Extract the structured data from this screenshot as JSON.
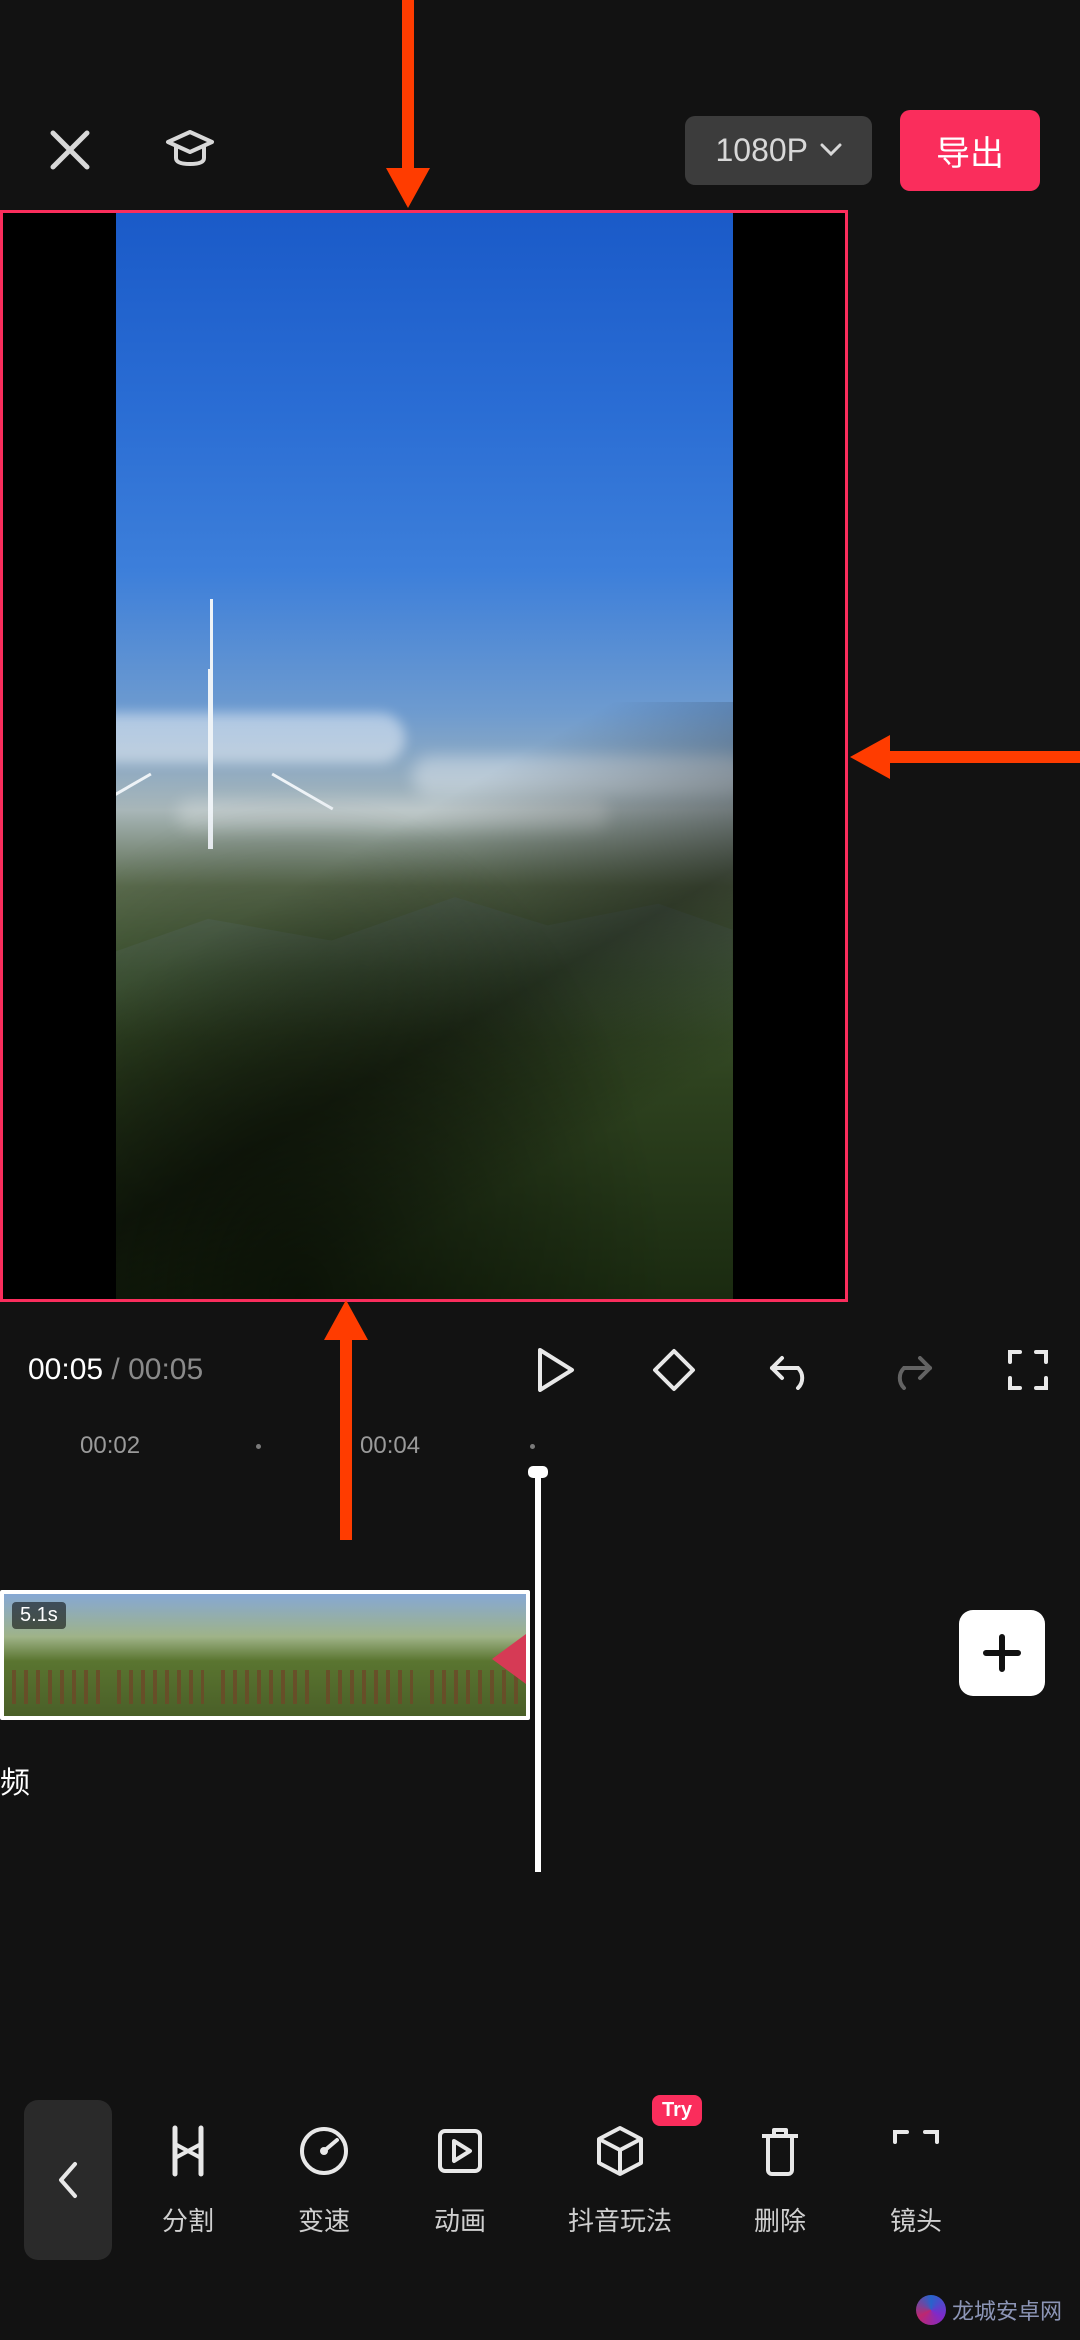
{
  "header": {
    "close_icon": "close",
    "tutorial_icon": "graduation-cap",
    "resolution_label": "1080P",
    "export_label": "导出"
  },
  "playback": {
    "current_time": "00:05",
    "separator": " / ",
    "duration": "00:05"
  },
  "ruler": {
    "marks": [
      "00:02",
      "00:04"
    ]
  },
  "timeline": {
    "clip_duration_label": "5.1s",
    "audio_track_label": "频",
    "add_label": "+"
  },
  "tools": {
    "back_icon": "chevron-left",
    "items": [
      {
        "id": "split",
        "label": "分割",
        "badge": null
      },
      {
        "id": "speed",
        "label": "变速",
        "badge": null
      },
      {
        "id": "anim",
        "label": "动画",
        "badge": null
      },
      {
        "id": "douyin",
        "label": "抖音玩法",
        "badge": "Try"
      },
      {
        "id": "delete",
        "label": "删除",
        "badge": null
      },
      {
        "id": "lens",
        "label": "镜头",
        "badge": null
      }
    ]
  },
  "watermark": {
    "text": "龙城安卓网"
  },
  "annotation": {
    "arrows": [
      "top-to-preview",
      "right-to-preview",
      "bottom-to-preview"
    ]
  },
  "colors": {
    "accent": "#fa2d5c",
    "annotation_arrow": "#ff3c00",
    "bg": "#121212"
  }
}
